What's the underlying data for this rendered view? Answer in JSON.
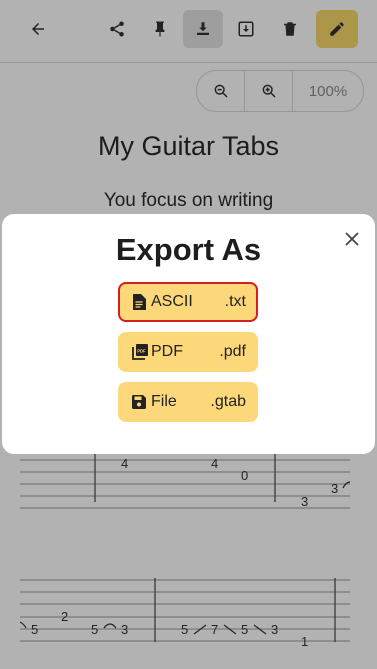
{
  "toolbar": {
    "back_icon": "arrow-left-icon",
    "share_icon": "share-icon",
    "pin_icon": "pin-icon",
    "download_icon": "download-icon",
    "archive_icon": "archive-icon",
    "delete_icon": "trash-icon",
    "edit_icon": "pencil-icon",
    "edit_color": "#f6d76a"
  },
  "zoom": {
    "out_icon": "zoom-out-icon",
    "in_icon": "zoom-in-icon",
    "value": "100%"
  },
  "document": {
    "title": "My Guitar Tabs",
    "subtitle": "You focus on writing"
  },
  "tab_staff_1": {
    "numbers": [
      "4",
      "4",
      "0",
      "3",
      "3"
    ]
  },
  "tab_staff_2": {
    "numbers": [
      "5",
      "2",
      "5",
      "3",
      "5",
      "7",
      "5",
      "3",
      "1"
    ]
  },
  "export_dialog": {
    "title": "Export As",
    "close_icon": "close-icon",
    "accent_color": "#fcd87b",
    "options": [
      {
        "label": "ASCII",
        "ext": ".txt",
        "icon": "text-file-icon"
      },
      {
        "label": "PDF",
        "ext": ".pdf",
        "icon": "pdf-icon"
      },
      {
        "label": "File",
        "ext": ".gtab",
        "icon": "save-icon"
      }
    ]
  }
}
